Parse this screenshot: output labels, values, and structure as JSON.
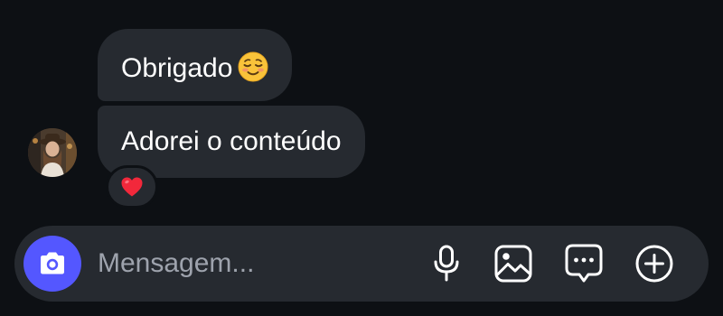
{
  "conversation": {
    "messages": [
      {
        "text": "Obrigado",
        "emoji": "relieved-face-emoji"
      },
      {
        "text": "Adorei o conteúdo",
        "reaction": "red-heart-emoji"
      }
    ]
  },
  "composer": {
    "placeholder": "Mensagem...",
    "value": "",
    "buttons": [
      "camera-icon",
      "microphone-icon",
      "gallery-icon",
      "sticker-message-icon",
      "plus-circle-icon"
    ]
  },
  "colors": {
    "background": "#0d1014",
    "bubble": "#262a30",
    "camera_button": "#5457ff",
    "placeholder": "#9ea3ad",
    "text": "#ffffff"
  }
}
